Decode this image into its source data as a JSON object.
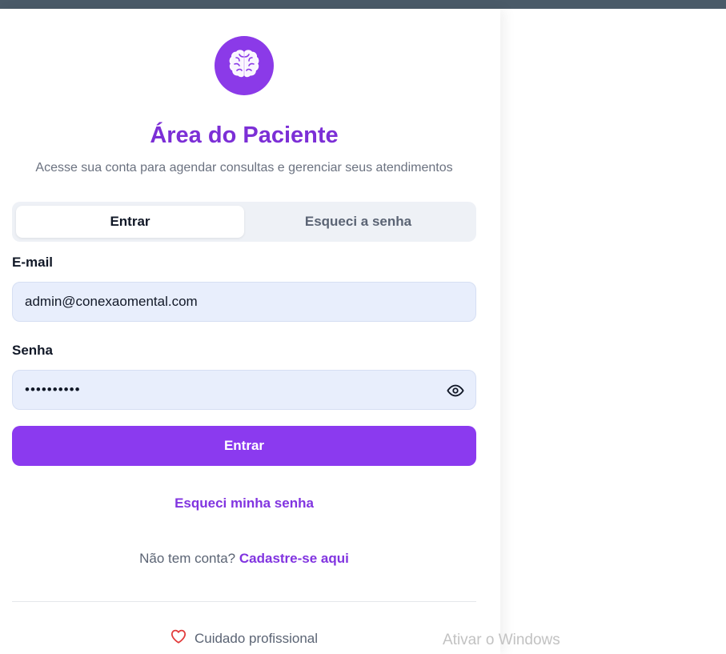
{
  "header": {
    "logo_icon": "brain-icon",
    "title": "Área do Paciente",
    "subtitle": "Acesse sua conta para agendar consultas e gerenciar seus atendimentos"
  },
  "tabs": [
    {
      "label": "Entrar",
      "active": true
    },
    {
      "label": "Esqueci a senha",
      "active": false
    }
  ],
  "form": {
    "email_label": "E-mail",
    "email_value": "admin@conexaomental.com",
    "password_label": "Senha",
    "password_value": "••••••••••",
    "password_toggle_icon": "eye-icon",
    "submit_label": "Entrar"
  },
  "links": {
    "forgot_password": "Esqueci minha senha",
    "no_account_text": "Não tem conta?",
    "signup_link": "Cadastre-se aqui"
  },
  "footer": {
    "icon": "heart-icon",
    "text": "Cuidado profissional"
  },
  "os_watermark": "Ativar o Windows",
  "colors": {
    "accent": "#8b3aef",
    "title": "#7c2fd6",
    "link": "#8134e0",
    "input_bg": "#e8eefc",
    "heart": "#e23b3b"
  }
}
